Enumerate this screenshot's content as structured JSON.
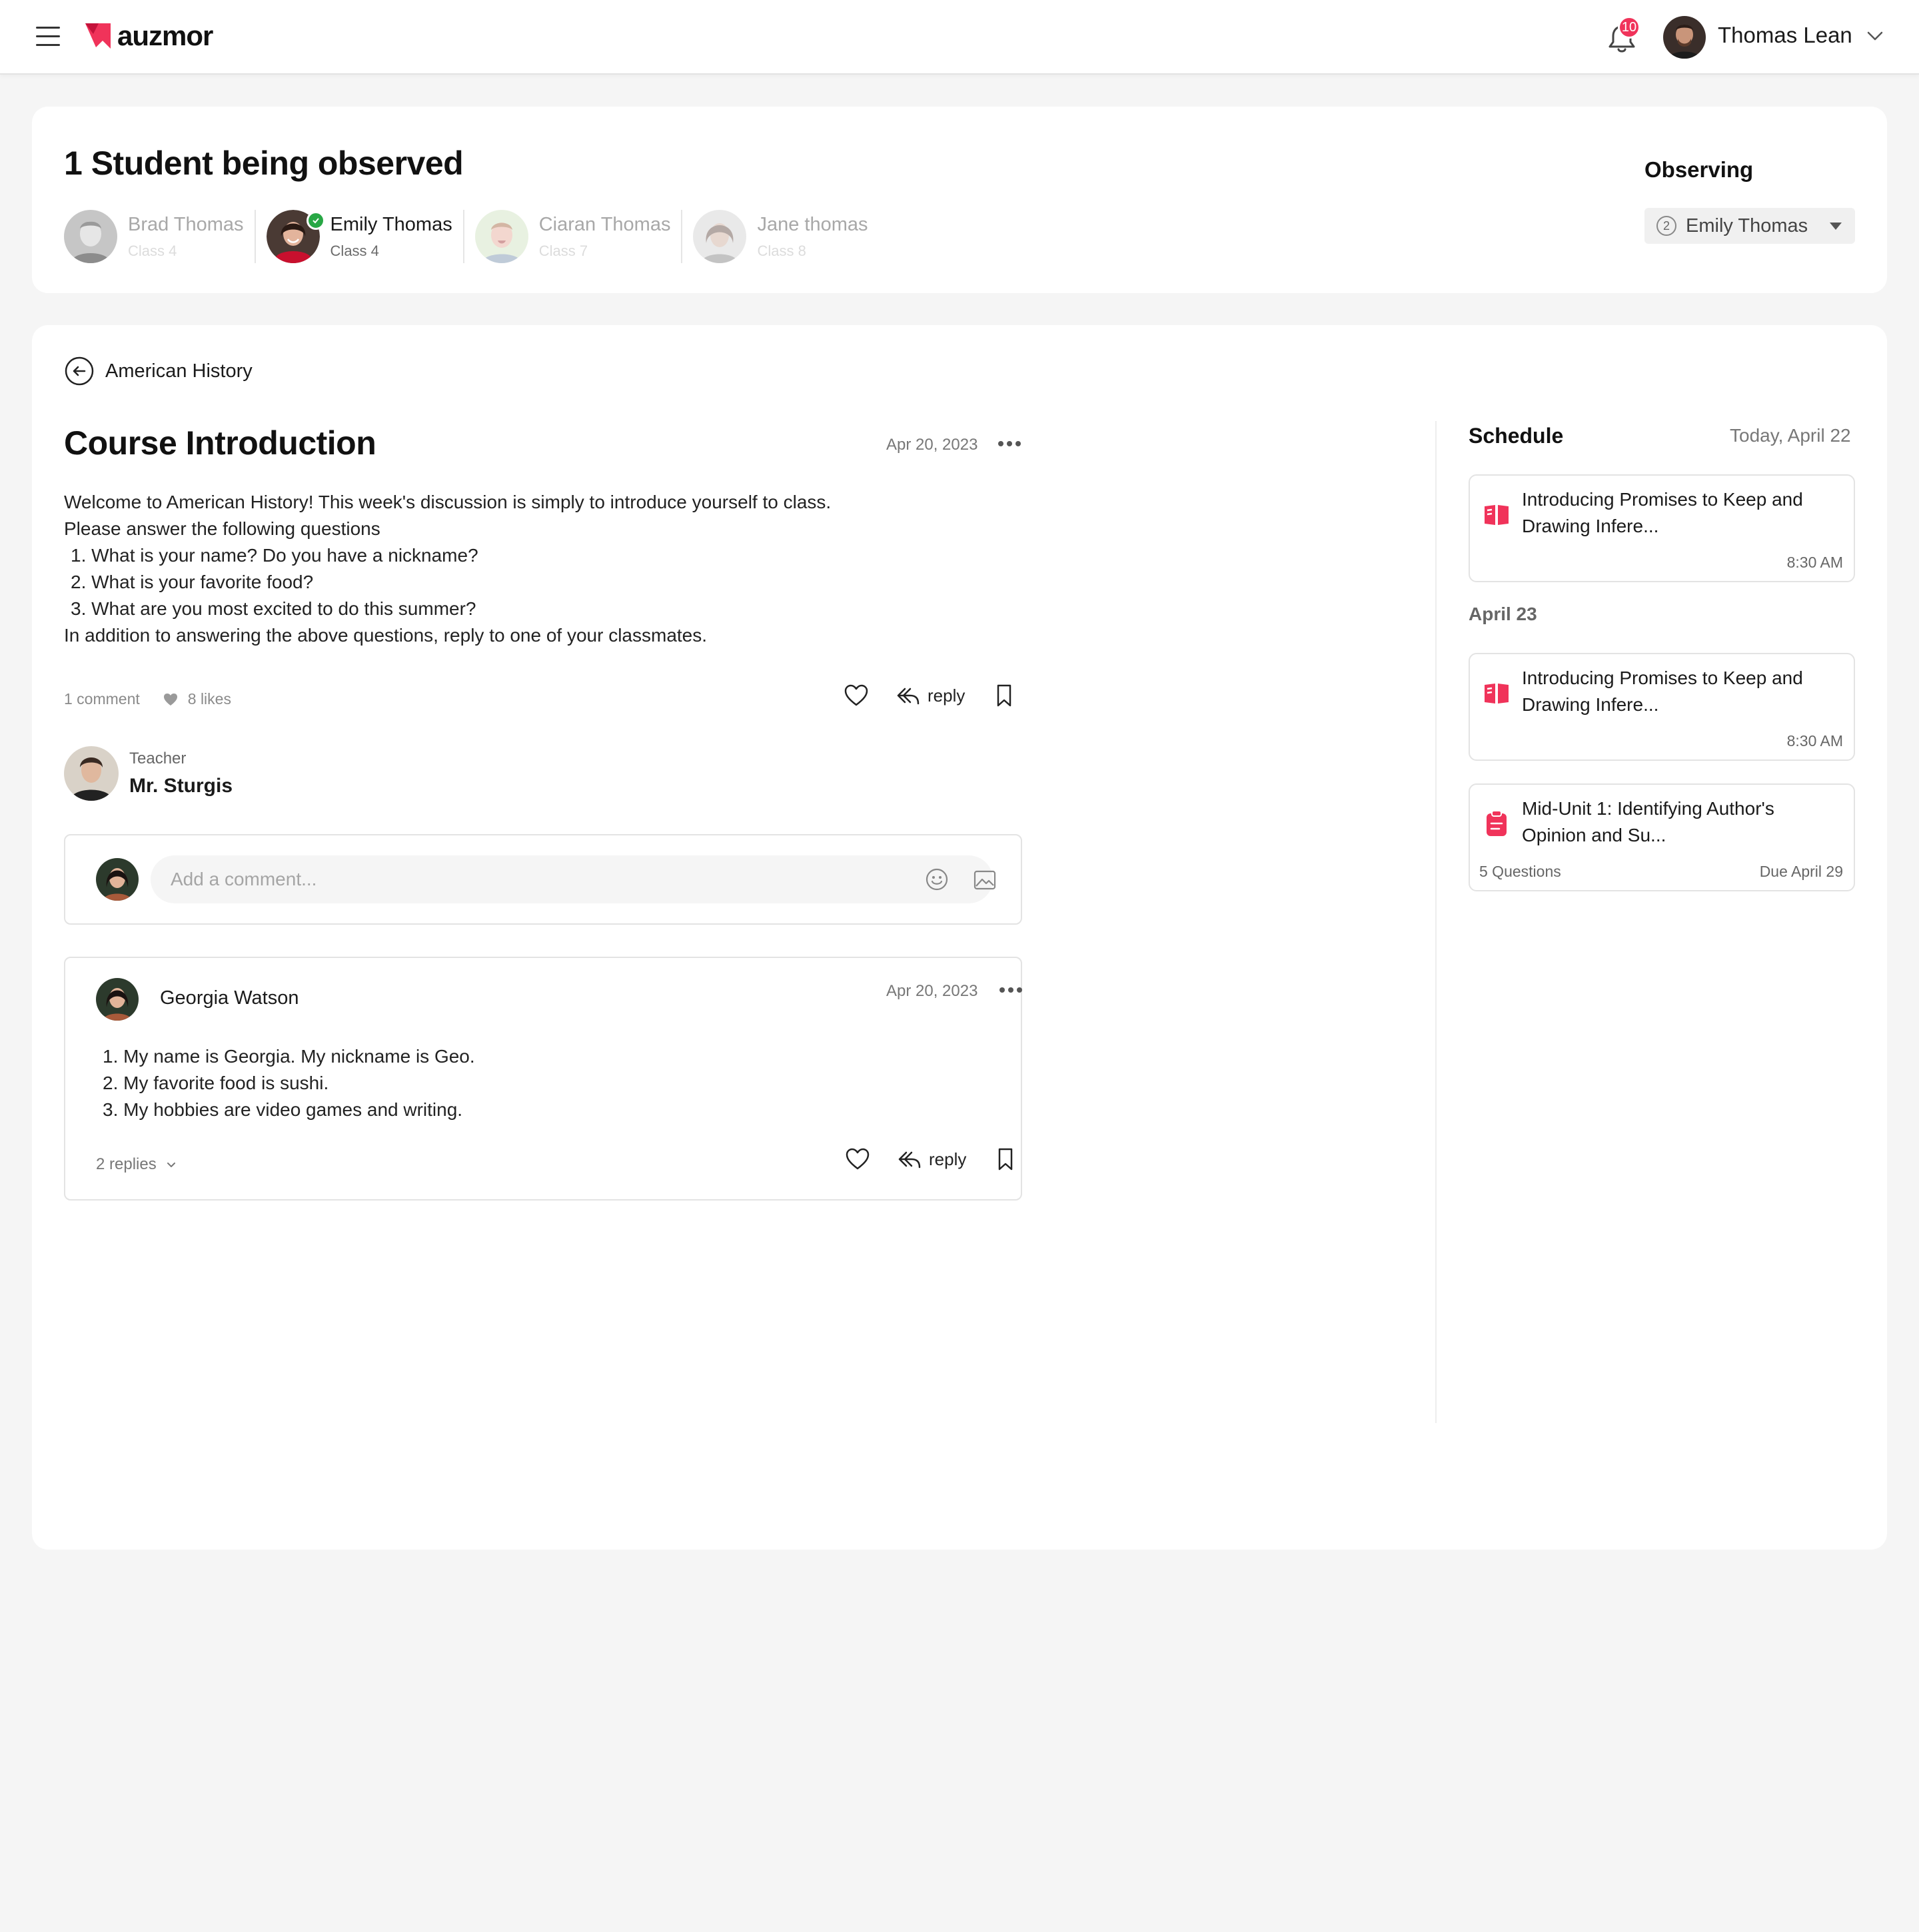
{
  "header": {
    "logo_text": "auzmor",
    "notification_count": "10",
    "user_name": "Thomas Lean"
  },
  "observed": {
    "title": "1 Student being observed",
    "observing_label": "Observing",
    "selected_count": "2",
    "selected_student": "Emily Thomas",
    "students": [
      {
        "name": "Brad Thomas",
        "class": "Class 4",
        "active": false
      },
      {
        "name": "Emily Thomas",
        "class": "Class 4",
        "active": true
      },
      {
        "name": "Ciaran Thomas",
        "class": "Class 7",
        "active": false
      },
      {
        "name": "Jane thomas",
        "class": "Class 8",
        "active": false
      }
    ]
  },
  "post": {
    "back_label": "American History",
    "title": "Course Introduction",
    "date": "Apr 20, 2023",
    "intro": "Welcome to American History! This week's discussion is simply to introduce yourself to class.",
    "prompt": "Please answer the following questions",
    "questions": [
      "1. What is your name? Do you have a nickname?",
      "2. What is your favorite food?",
      "3. What are you most excited to do this summer?"
    ],
    "outro": "In addition to answering the above questions, reply to one of your classmates.",
    "comments_count": "1 comment",
    "likes_count": "8 likes",
    "reply_label": "reply"
  },
  "teacher": {
    "role": "Teacher",
    "name": "Mr. Sturgis"
  },
  "comment_box": {
    "placeholder": "Add a comment..."
  },
  "reply": {
    "author": "Georgia Watson",
    "date": "Apr 20, 2023",
    "lines": [
      "1. My name is Georgia. My nickname is Geo.",
      "2. My favorite food is sushi.",
      "3. My hobbies are video games and writing."
    ],
    "replies_count": "2 replies",
    "reply_label": "reply"
  },
  "schedule": {
    "title": "Schedule",
    "today_label": "Today, April 22",
    "second_date": "April 23",
    "items": [
      {
        "title": "Introducing Promises to Keep and Drawing Infere...",
        "time": "8:30 AM",
        "icon": "book-open-icon"
      },
      {
        "title": "Introducing Promises to Keep and Drawing Infere...",
        "time": "8:30 AM",
        "icon": "book-open-icon"
      },
      {
        "title": "Mid-Unit 1: Identifying Author's Opinion and Su...",
        "questions": "5 Questions",
        "due": "Due April 29",
        "icon": "clipboard-icon"
      }
    ]
  },
  "colors": {
    "accent": "#f0335a",
    "success": "#28a745",
    "background": "#f5f5f5"
  }
}
